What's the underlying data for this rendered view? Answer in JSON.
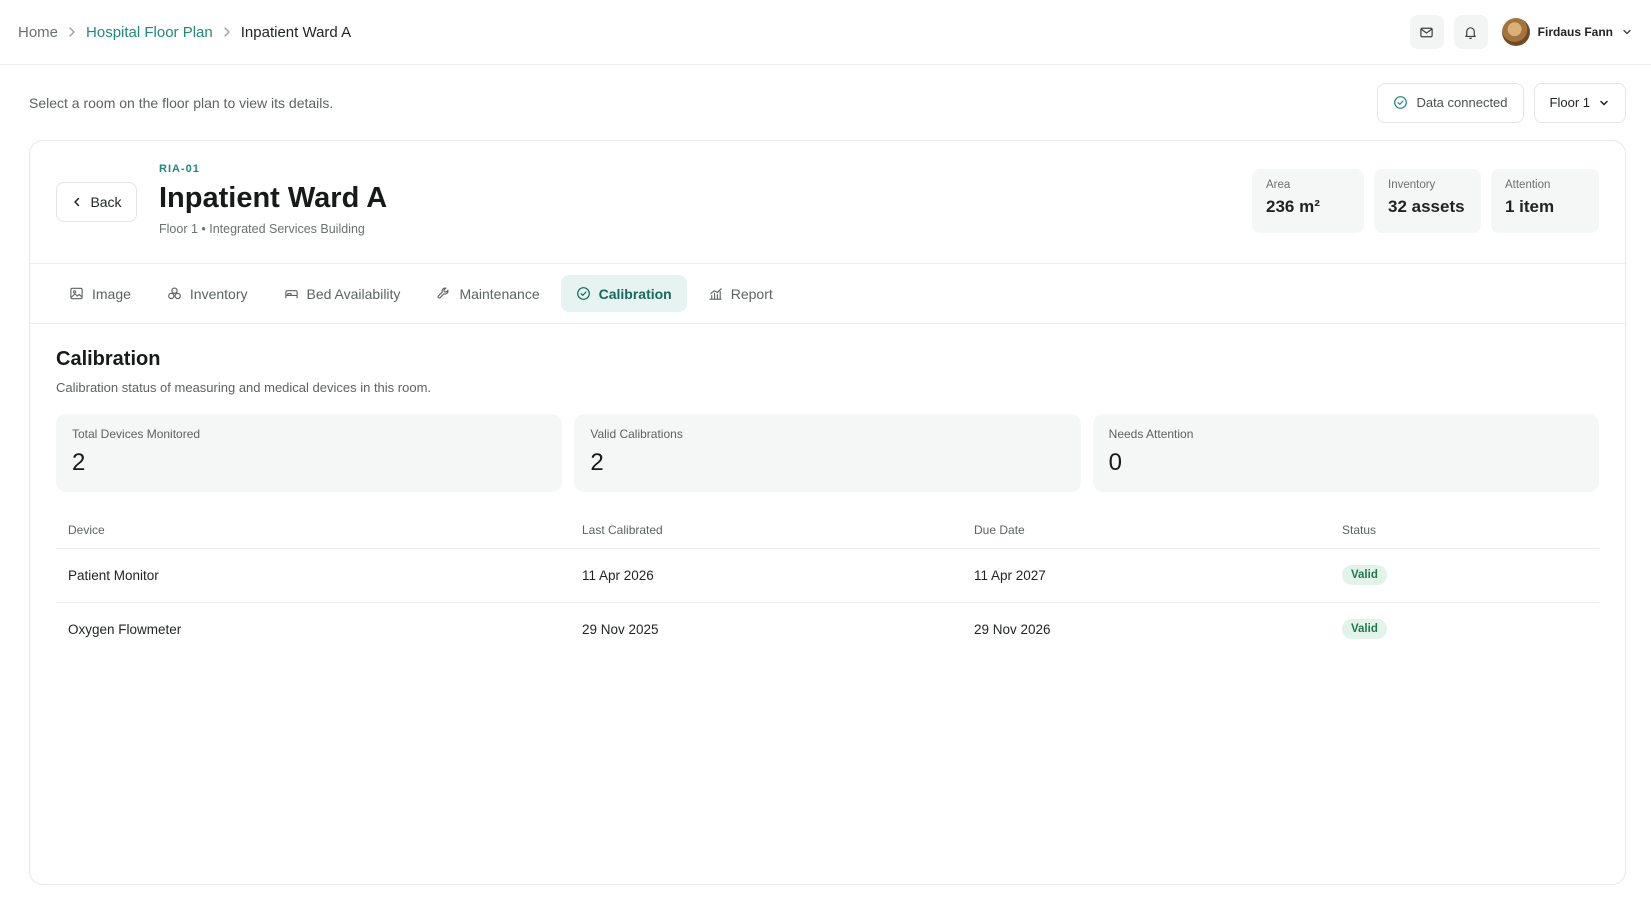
{
  "breadcrumb": {
    "home": "Home",
    "floor_plan": "Hospital Floor Plan",
    "current": "Inpatient Ward A"
  },
  "user": {
    "name": "Firdaus Fann"
  },
  "subbar": {
    "hint": "Select a room on the floor plan to view its details.",
    "status": "Data connected",
    "floor_select": "Floor 1"
  },
  "room": {
    "back_label": "Back",
    "code": "RIA-01",
    "title": "Inpatient Ward A",
    "subtitle": "Floor 1 • Integrated Services Building",
    "stats": [
      {
        "label": "Area",
        "value": "236 m²"
      },
      {
        "label": "Inventory",
        "value": "32 assets"
      },
      {
        "label": "Attention",
        "value": "1 item"
      }
    ]
  },
  "tabs": [
    {
      "label": "Image",
      "icon": "image-icon"
    },
    {
      "label": "Inventory",
      "icon": "boxes-icon"
    },
    {
      "label": "Bed Availability",
      "icon": "bed-icon"
    },
    {
      "label": "Maintenance",
      "icon": "wrench-icon"
    },
    {
      "label": "Calibration",
      "icon": "check-circle-icon",
      "active": true
    },
    {
      "label": "Report",
      "icon": "chart-icon"
    }
  ],
  "calibration": {
    "title": "Calibration",
    "description": "Calibration status of measuring and medical devices in this room.",
    "metrics": [
      {
        "label": "Total Devices Monitored",
        "value": "2"
      },
      {
        "label": "Valid Calibrations",
        "value": "2"
      },
      {
        "label": "Needs Attention",
        "value": "0"
      }
    ],
    "columns": [
      "Device",
      "Last Calibrated",
      "Due Date",
      "Status"
    ],
    "rows": [
      {
        "device": "Patient Monitor",
        "last": "11 Apr 2026",
        "due": "11 Apr 2027",
        "status": "Valid"
      },
      {
        "device": "Oxygen Flowmeter",
        "last": "29 Nov 2025",
        "due": "29 Nov 2026",
        "status": "Valid"
      }
    ]
  },
  "colors": {
    "accent": "#1e8a7a",
    "active_tab_bg": "#e6f3f1",
    "valid_badge_bg": "#e2f3ea",
    "valid_badge_text": "#1e7a4c"
  }
}
